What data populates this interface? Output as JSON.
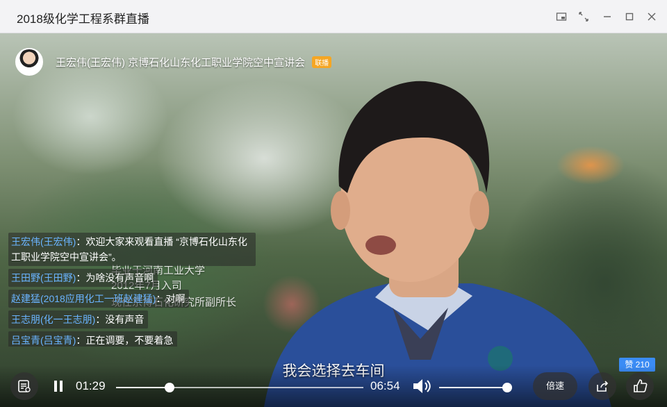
{
  "window": {
    "title": "2018级化学工程系群直播"
  },
  "host": {
    "name": "王宏伟(王宏伟)",
    "lecture": "京博石化山东化工职业学院空中宣讲会",
    "tag": "联播"
  },
  "comments": [
    {
      "user": "王宏伟(王宏伟)",
      "text": "：欢迎大家来观看直播 “京博石化山东化工职业学院空中宣讲会”。"
    },
    {
      "user": "王田野(王田野)",
      "text": "：为啥没有声音啊"
    },
    {
      "user": "赵建猛(2018应用化工一班赵建猛)",
      "text": "：对啊"
    },
    {
      "user": "王志朋(化一王志朋)",
      "text": "：没有声音"
    },
    {
      "user": "吕宝青(吕宝青)",
      "text": "：正在调要，不要着急"
    }
  ],
  "video_overlay": {
    "line1": "毕业于河南工业大学",
    "line2": "2012年7月入司",
    "line3": "现任京博石化研究所副所长"
  },
  "subtitle": "我会选择去车间",
  "likes": "赞 210",
  "player": {
    "current_time": "01:29",
    "duration": "06:54",
    "progress": 0.215,
    "volume": 1.0,
    "speed_label": "倍速"
  },
  "colors": {
    "accent": "#3b8cf5",
    "username": "#6ab4ff",
    "tag": "#f5a623"
  }
}
